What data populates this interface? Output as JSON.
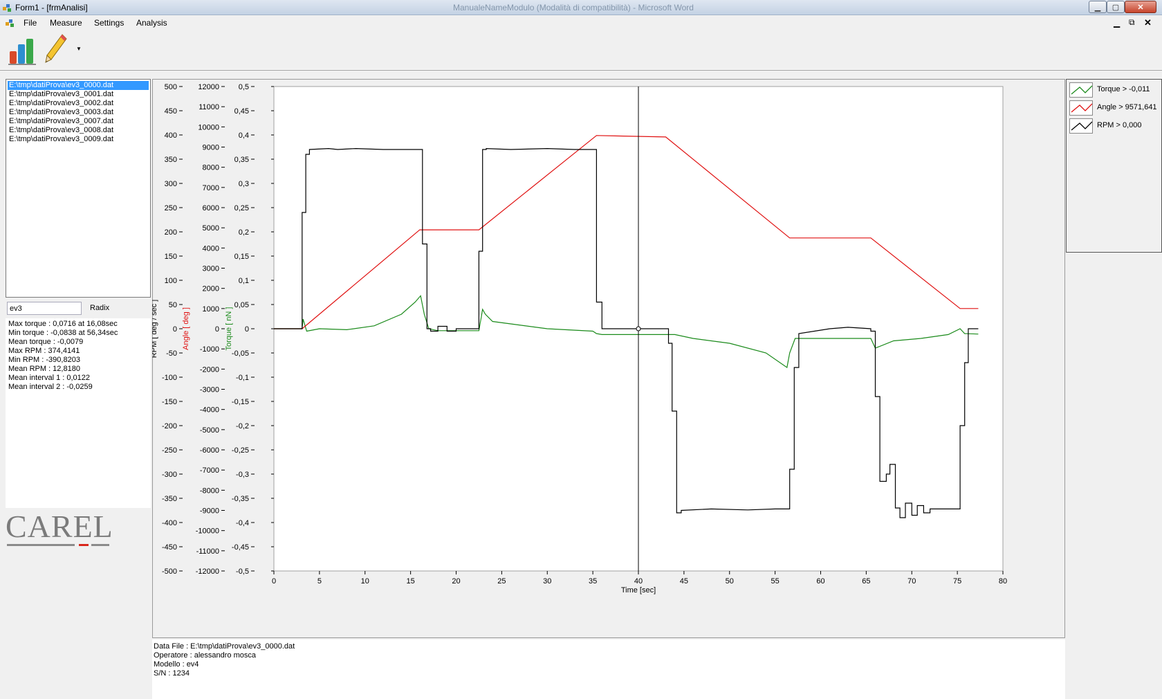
{
  "window": {
    "title": "Form1 - [frmAnalisi]",
    "ghost_title": "ManualeNameModulo (Modalità di compatibilità) - Microsoft Word"
  },
  "menu": {
    "items": [
      "File",
      "Measure",
      "Settings",
      "Analysis"
    ]
  },
  "toolbar": {
    "chart_tool_icon": "bar-chart-icon",
    "edit_tool_icon": "pencil-icon",
    "dropdown_icon": "chevron-down-icon"
  },
  "files": {
    "items": [
      "E:\\tmp\\datiProva\\ev3_0000.dat",
      "E:\\tmp\\datiProva\\ev3_0001.dat",
      "E:\\tmp\\datiProva\\ev3_0002.dat",
      "E:\\tmp\\datiProva\\ev3_0003.dat",
      "E:\\tmp\\datiProva\\ev3_0007.dat",
      "E:\\tmp\\datiProva\\ev3_0008.dat",
      "E:\\tmp\\datiProva\\ev3_0009.dat"
    ],
    "selected_index": 0
  },
  "filter": {
    "value": "ev3",
    "radix_label": "Radix"
  },
  "stats": [
    "Max torque : 0,0716 at 16,08sec",
    "Min torque : -0,0838 at 56,34sec",
    "Mean torque : -0,0079",
    "Max RPM : 374,4141",
    "Min RPM : -390,8203",
    "Mean RPM : 12,8180",
    "Mean interval 1 : 0,0122",
    "Mean interval 2 : -0,0259"
  ],
  "logo": {
    "text": "CAREL"
  },
  "legend": [
    {
      "label": "Torque > -0,011",
      "color": "#1a8a1a"
    },
    {
      "label": "Angle > 9571,641",
      "color": "#e01010"
    },
    {
      "label": "RPM > 0,000",
      "color": "#000000"
    }
  ],
  "info": [
    "Data File : E:\\tmp\\datiProva\\ev3_0000.dat",
    "Operatore : alessandro mosca",
    "Modello : ev4",
    "S/N : 1234"
  ],
  "chart_data": {
    "type": "line",
    "xlabel": "Time [sec]",
    "xlim": [
      0,
      80
    ],
    "x_ticks": [
      0,
      5,
      10,
      15,
      20,
      25,
      30,
      35,
      40,
      45,
      50,
      55,
      60,
      65,
      70,
      75,
      80
    ],
    "cursor_x": 40,
    "axes": [
      {
        "id": "rpm",
        "label": "RPM [ deg / sec ]",
        "color": "#000000",
        "ylim": [
          -500,
          500
        ],
        "ticks": [
          "500",
          "450",
          "400",
          "350",
          "300",
          "250",
          "200",
          "150",
          "100",
          "50",
          "0",
          "-50",
          "-100",
          "-150",
          "-200",
          "-250",
          "-300",
          "-350",
          "-400",
          "-450",
          "-500"
        ]
      },
      {
        "id": "angle",
        "label": "Angle [ deg ]",
        "color": "#e01010",
        "ylim": [
          -12000,
          12000
        ],
        "ticks": [
          "12000",
          "11000",
          "10000",
          "9000",
          "8000",
          "7000",
          "6000",
          "5000",
          "4000",
          "3000",
          "2000",
          "1000",
          "0",
          "-1000",
          "-2000",
          "-3000",
          "-4000",
          "-5000",
          "-6000",
          "-7000",
          "-8000",
          "-9000",
          "-10000",
          "-11000",
          "-12000"
        ]
      },
      {
        "id": "torque",
        "label": "Torque [ nN ]",
        "color": "#1a8a1a",
        "ylim": [
          -0.5,
          0.5
        ],
        "ticks": [
          "0,5",
          "0,45",
          "0,4",
          "0,35",
          "0,3",
          "0,25",
          "0,2",
          "0,15",
          "0,1",
          "0,05",
          "0",
          "-0,05",
          "-0,1",
          "-0,15",
          "-0,2",
          "-0,25",
          "-0,3",
          "-0,35",
          "-0,4",
          "-0,45",
          "-0,5"
        ]
      }
    ],
    "series": [
      {
        "name": "RPM",
        "color": "#000000",
        "axis": "rpm",
        "x": [
          0,
          3.1,
          3.1,
          3.5,
          3.5,
          3.9,
          3.9,
          6,
          7,
          9,
          12,
          15,
          16.3,
          16.3,
          16.8,
          16.8,
          17.2,
          17.2,
          18,
          18,
          19,
          19,
          20,
          20,
          22.5,
          22.5,
          22.9,
          22.9,
          23.3,
          23.3,
          26,
          30,
          33,
          35.4,
          35.4,
          36,
          36,
          36.5,
          36.5,
          40,
          42,
          43,
          43.3,
          43.3,
          43.7,
          43.7,
          44.2,
          44.2,
          44.7,
          44.7,
          48,
          52,
          55,
          56.6,
          56.6,
          57.1,
          57.1,
          57.6,
          57.6,
          61,
          63,
          65.5,
          65.5,
          66,
          66,
          66.5,
          66.5,
          67.2,
          67.2,
          67.6,
          67.6,
          68.2,
          68.2,
          68.7,
          68.7,
          69.3,
          69.3,
          70,
          70,
          70.6,
          70.6,
          71.3,
          71.3,
          72,
          72,
          75.3,
          75.3,
          75.8,
          75.8,
          76.2,
          76.2,
          77.3
        ],
        "y": [
          0,
          0,
          240,
          240,
          360,
          360,
          370,
          372,
          370,
          372,
          370,
          370,
          370,
          175,
          175,
          0,
          0,
          -5,
          -5,
          5,
          5,
          -5,
          -5,
          0,
          0,
          160,
          160,
          370,
          370,
          372,
          370,
          372,
          370,
          370,
          55,
          55,
          0,
          0,
          0,
          0,
          0,
          0,
          0,
          -30,
          -30,
          -170,
          -170,
          -380,
          -380,
          -375,
          -372,
          -374,
          -372,
          -372,
          -290,
          -290,
          -80,
          -80,
          -10,
          0,
          3,
          0,
          -5,
          -5,
          -140,
          -140,
          -315,
          -315,
          -300,
          -300,
          -280,
          -280,
          -370,
          -370,
          -390,
          -390,
          -360,
          -360,
          -385,
          -385,
          -365,
          -365,
          -380,
          -380,
          -372,
          -372,
          -200,
          -200,
          -70,
          -70,
          0,
          0
        ]
      },
      {
        "name": "Angle",
        "color": "#e01010",
        "axis": "angle",
        "x": [
          0,
          3.1,
          16,
          22.5,
          35.4,
          43,
          56.6,
          65.5,
          75.3,
          77.3
        ],
        "y": [
          0,
          0,
          4900,
          4900,
          9571,
          9500,
          4500,
          4500,
          1000,
          1000
        ]
      },
      {
        "name": "Torque",
        "color": "#1a8a1a",
        "axis": "torque",
        "x": [
          0,
          3.1,
          3.2,
          3.6,
          5,
          8,
          11,
          14,
          15.5,
          16.1,
          16.5,
          17,
          18,
          20,
          22.5,
          22.9,
          23.2,
          24,
          26,
          30,
          35,
          35.4,
          36,
          40,
          43,
          44,
          46,
          50,
          54,
          56.3,
          56.6,
          57.2,
          60,
          63,
          65.5,
          66,
          68,
          71,
          74,
          75.3,
          75.8,
          77.3
        ],
        "y": [
          0,
          0,
          0.02,
          -0.005,
          0.0,
          -0.002,
          0.006,
          0.03,
          0.055,
          0.068,
          0.03,
          0.0,
          -0.004,
          -0.004,
          -0.004,
          0.04,
          0.03,
          0.015,
          0.01,
          0.0,
          -0.005,
          -0.01,
          -0.012,
          -0.012,
          -0.012,
          -0.012,
          -0.02,
          -0.03,
          -0.05,
          -0.08,
          -0.05,
          -0.02,
          -0.02,
          -0.02,
          -0.02,
          -0.04,
          -0.025,
          -0.02,
          -0.012,
          0.0,
          -0.01,
          -0.011
        ]
      }
    ]
  }
}
